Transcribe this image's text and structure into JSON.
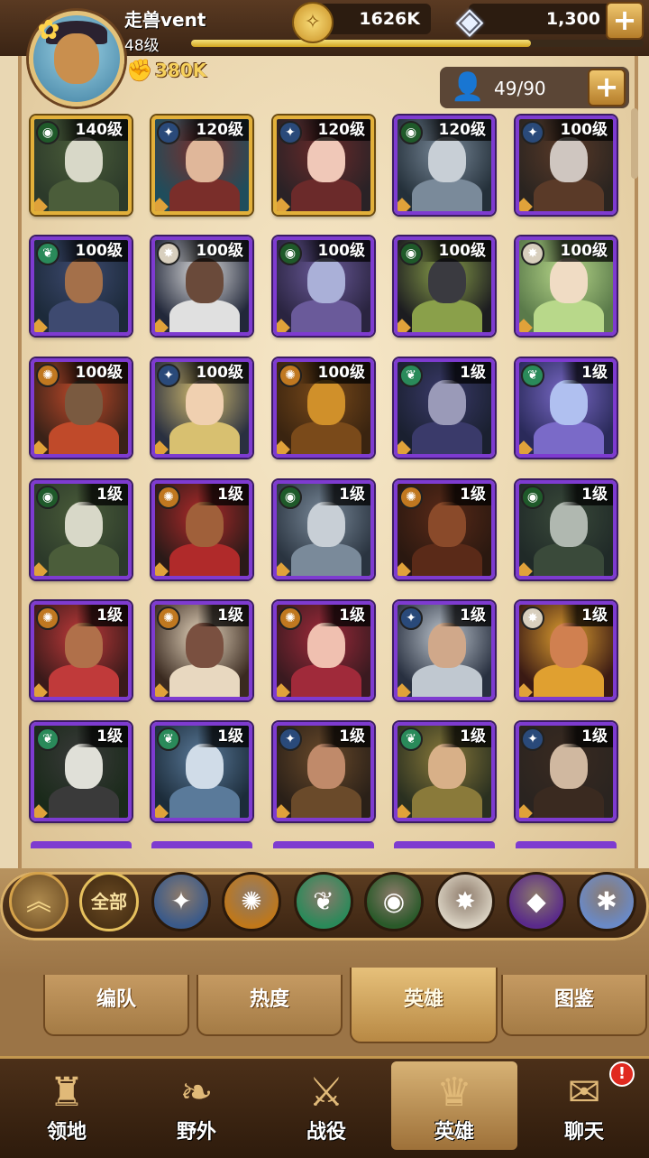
{
  "player": {
    "name": "走兽vent",
    "level": "48级",
    "xp_fraction": 0.75,
    "power": "380K"
  },
  "resources": {
    "gold": "1626K",
    "diamonds": "1,300",
    "add_label": "+"
  },
  "roster": {
    "count": "49/90",
    "add_label": "+"
  },
  "colors": {
    "epic_border": "#7e3bd0",
    "legendary_border": "#e2b03a"
  },
  "heroes": [
    {
      "level": "140级",
      "faction": "forest-eye",
      "rarity": "legendary",
      "palette": [
        "#2c3a2a",
        "#d8d8c8",
        "#4b5d3a"
      ]
    },
    {
      "level": "120级",
      "faction": "light-star",
      "rarity": "legendary",
      "palette": [
        "#1f4d5c",
        "#e0b79a",
        "#7a2e2a"
      ]
    },
    {
      "level": "120级",
      "faction": "light-star",
      "rarity": "legendary",
      "palette": [
        "#2a2226",
        "#f0c8b8",
        "#6b2a2a"
      ]
    },
    {
      "level": "120级",
      "faction": "forest-eye",
      "rarity": "epic",
      "palette": [
        "#24303a",
        "#c8cfd6",
        "#7a8a9a"
      ]
    },
    {
      "level": "100级",
      "faction": "light-star",
      "rarity": "epic",
      "palette": [
        "#2a2420",
        "#cfc6c0",
        "#5a3a28"
      ]
    },
    {
      "level": "100级",
      "faction": "nature-leaf",
      "rarity": "epic",
      "palette": [
        "#1c2a3a",
        "#a4704a",
        "#3e4a70"
      ]
    },
    {
      "level": "100级",
      "faction": "holy-burst",
      "rarity": "epic",
      "palette": [
        "#22283a",
        "#6a4a3a",
        "#e0e0e0"
      ]
    },
    {
      "level": "100级",
      "faction": "forest-eye",
      "rarity": "epic",
      "palette": [
        "#2a2440",
        "#aab0d8",
        "#6a5a9a"
      ]
    },
    {
      "level": "100级",
      "faction": "forest-eye",
      "rarity": "epic",
      "palette": [
        "#1c1c20",
        "#3a3a40",
        "#8aa04a"
      ]
    },
    {
      "level": "100级",
      "faction": "holy-burst",
      "rarity": "epic",
      "palette": [
        "#5a7a4a",
        "#f0dcc4",
        "#b8d88a"
      ]
    },
    {
      "level": "100级",
      "faction": "sun-fire",
      "rarity": "epic",
      "palette": [
        "#3a2218",
        "#7a5a40",
        "#c04a2a"
      ]
    },
    {
      "level": "100级",
      "faction": "light-star",
      "rarity": "epic",
      "palette": [
        "#2a3040",
        "#f0d0b0",
        "#d8c070"
      ]
    },
    {
      "level": "100级",
      "faction": "sun-fire",
      "rarity": "epic",
      "palette": [
        "#3a2410",
        "#d0902a",
        "#7a4a1a"
      ]
    },
    {
      "level": "1级",
      "faction": "nature-leaf",
      "rarity": "epic",
      "palette": [
        "#1a2030",
        "#9a9ab8",
        "#3a3a6a"
      ]
    },
    {
      "level": "1级",
      "faction": "nature-leaf",
      "rarity": "epic",
      "palette": [
        "#2a2a5a",
        "#b0c0f0",
        "#7a6ac8"
      ]
    },
    {
      "level": "1级",
      "faction": "forest-eye",
      "rarity": "epic",
      "palette": [
        "#2c3a2a",
        "#d8d8c8",
        "#4b5d3a"
      ]
    },
    {
      "level": "1级",
      "faction": "sun-fire",
      "rarity": "epic",
      "palette": [
        "#2a1a18",
        "#a0603a",
        "#b02a2a"
      ]
    },
    {
      "level": "1级",
      "faction": "forest-eye",
      "rarity": "epic",
      "palette": [
        "#2a3440",
        "#c8cfd6",
        "#7a8a9a"
      ]
    },
    {
      "level": "1级",
      "faction": "sun-fire",
      "rarity": "epic",
      "palette": [
        "#2a1810",
        "#8a4a2a",
        "#5a2a18"
      ]
    },
    {
      "level": "1级",
      "faction": "forest-eye",
      "rarity": "epic",
      "palette": [
        "#202a28",
        "#b0b8b0",
        "#3a4a3a"
      ]
    },
    {
      "level": "1级",
      "faction": "sun-fire",
      "rarity": "epic",
      "palette": [
        "#3a1a1a",
        "#b0704a",
        "#c03a3a"
      ]
    },
    {
      "level": "1级",
      "faction": "sun-fire",
      "rarity": "epic",
      "palette": [
        "#3a2a20",
        "#7a5040",
        "#e8d8c0"
      ]
    },
    {
      "level": "1级",
      "faction": "sun-fire",
      "rarity": "epic",
      "palette": [
        "#3a1a20",
        "#f0c0b0",
        "#a02a3a"
      ]
    },
    {
      "level": "1级",
      "faction": "light-star",
      "rarity": "epic",
      "palette": [
        "#283040",
        "#d0a88a",
        "#c0c8d0"
      ]
    },
    {
      "level": "1级",
      "faction": "holy-burst",
      "rarity": "epic",
      "palette": [
        "#3a1a14",
        "#d08050",
        "#e0a030"
      ]
    },
    {
      "level": "1级",
      "faction": "nature-leaf",
      "rarity": "epic",
      "palette": [
        "#1a2a1a",
        "#e0e0d8",
        "#3a3a3a"
      ]
    },
    {
      "level": "1级",
      "faction": "nature-leaf",
      "rarity": "epic",
      "palette": [
        "#1c2c3a",
        "#d0dce8",
        "#5a7a9a"
      ]
    },
    {
      "level": "1级",
      "faction": "light-star",
      "rarity": "epic",
      "palette": [
        "#2a2018",
        "#c08a6a",
        "#6a4a2a"
      ]
    },
    {
      "level": "1级",
      "faction": "nature-leaf",
      "rarity": "epic",
      "palette": [
        "#2a3020",
        "#d8b088",
        "#8a7a3a"
      ]
    },
    {
      "level": "1级",
      "faction": "light-star",
      "rarity": "epic",
      "palette": [
        "#2a2420",
        "#d0b8a0",
        "#3a2a20"
      ]
    }
  ],
  "factions": [
    {
      "id": "expand",
      "icon": "chevrons-up-icon",
      "glyph": "︽"
    },
    {
      "id": "all",
      "label": "全部"
    },
    {
      "id": "light-star",
      "icon": "star-compass-icon",
      "glyph": "✦",
      "bg": "#3a5a8a"
    },
    {
      "id": "sun-fire",
      "icon": "sun-emblem-icon",
      "glyph": "✺",
      "bg": "#c0781a"
    },
    {
      "id": "nature-leaf",
      "icon": "leaf-icon",
      "glyph": "❦",
      "bg": "#2a8a5a"
    },
    {
      "id": "forest-eye",
      "icon": "eye-icon",
      "glyph": "◉",
      "bg": "#2a5a2a"
    },
    {
      "id": "holy-burst",
      "icon": "starburst-icon",
      "glyph": "✸",
      "bg": "#d8d0c0"
    },
    {
      "id": "void",
      "icon": "void-crystal-icon",
      "glyph": "◆",
      "bg": "#5a2a8a"
    },
    {
      "id": "arcane",
      "icon": "arcane-circle-icon",
      "glyph": "✱",
      "bg": "#6a8ac8"
    }
  ],
  "tabs": [
    {
      "label": "编队",
      "active": false
    },
    {
      "label": "热度",
      "active": false
    },
    {
      "label": "英雄",
      "active": true
    },
    {
      "label": "图鉴",
      "active": false
    }
  ],
  "nav": [
    {
      "label": "领地",
      "icon": "castle-icon",
      "glyph": "♜",
      "active": false
    },
    {
      "label": "野外",
      "icon": "map-scroll-icon",
      "glyph": "❧",
      "active": false
    },
    {
      "label": "战役",
      "icon": "sword-shield-icon",
      "glyph": "⚔",
      "active": false
    },
    {
      "label": "英雄",
      "icon": "helmet-icon",
      "glyph": "♛",
      "active": true
    },
    {
      "label": "聊天",
      "icon": "chat-bubble-icon",
      "glyph": "✉",
      "active": false
    }
  ],
  "chat_badge": "!"
}
